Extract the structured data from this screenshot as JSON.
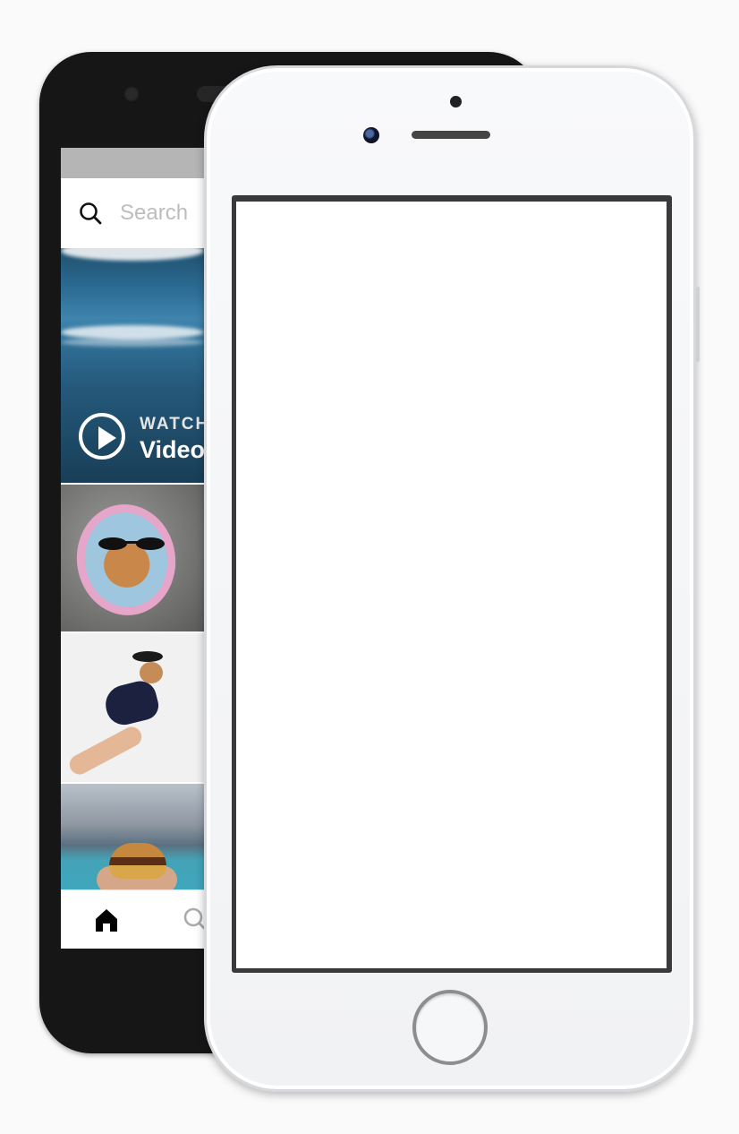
{
  "android_app": {
    "search": {
      "placeholder": "Search"
    },
    "video_tile": {
      "overline": "WATCH",
      "title": "Video"
    },
    "tabs": [
      {
        "name": "home",
        "icon": "home-icon"
      },
      {
        "name": "search",
        "icon": "search-icon"
      }
    ]
  },
  "colors": {
    "android_body": "#161616",
    "iphone_body": "#f4f5f6",
    "screen_bezel": "#3a3a3c",
    "status_bar": "#b5b5b5"
  }
}
